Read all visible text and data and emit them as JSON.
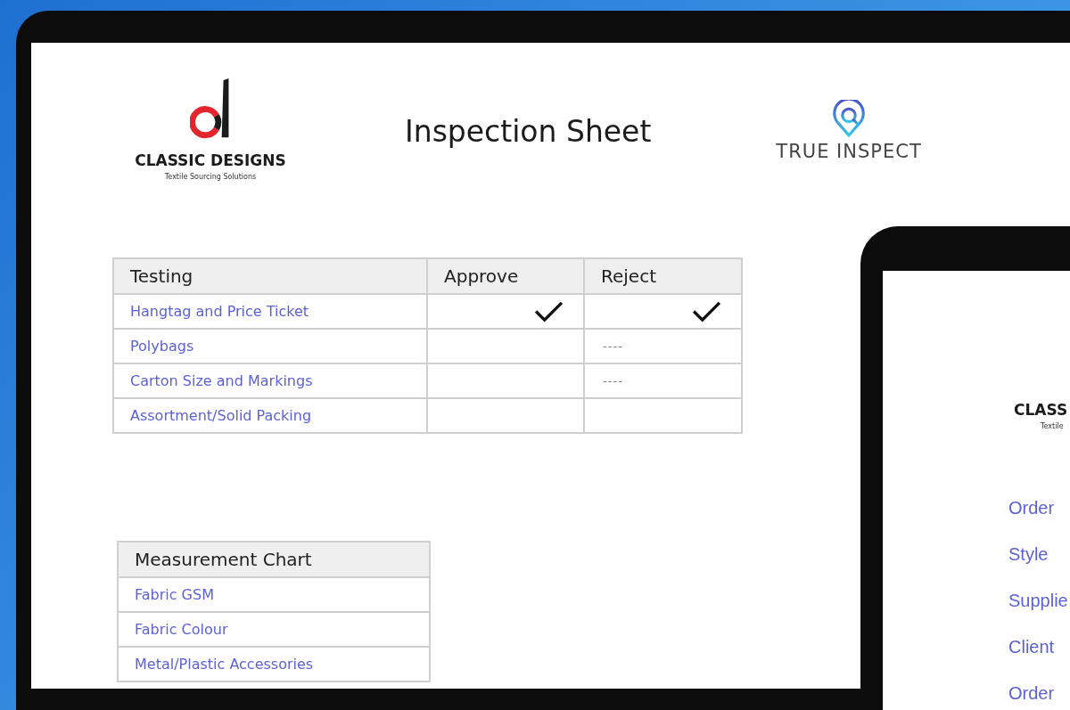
{
  "laptop": {
    "header": {
      "brand": {
        "name": "CLASSIC DESIGNS",
        "tagline": "Textile Sourcing Solutions"
      },
      "title": "Inspection Sheet",
      "partner": {
        "name": "TRUE INSPECT"
      }
    },
    "testing_table": {
      "columns": [
        "Testing",
        "Approve",
        "Reject"
      ],
      "rows": [
        {
          "label": "Hangtag and Price Ticket",
          "approve": {
            "checked": true
          },
          "reject": {
            "checked": true
          }
        },
        {
          "label": "Polybags",
          "approve": {
            "checked": false
          },
          "reject": {
            "checked": false,
            "text": "----"
          }
        },
        {
          "label": "Carton Size and Markings",
          "approve": {
            "checked": false
          },
          "reject": {
            "checked": false,
            "text": "----"
          }
        },
        {
          "label": "Assortment/Solid Packing",
          "approve": {
            "checked": false
          },
          "reject": {
            "checked": false
          }
        }
      ]
    },
    "measurement_table": {
      "title": "Measurement Chart",
      "rows": [
        "Fabric GSM",
        "Fabric Colour",
        "Metal/Plastic Accessories"
      ]
    }
  },
  "tablet": {
    "brand": {
      "name": "CLASS",
      "tagline": "Textile"
    },
    "fields": [
      "Order",
      "Style",
      "Supplie",
      "Client",
      "Order"
    ]
  }
}
